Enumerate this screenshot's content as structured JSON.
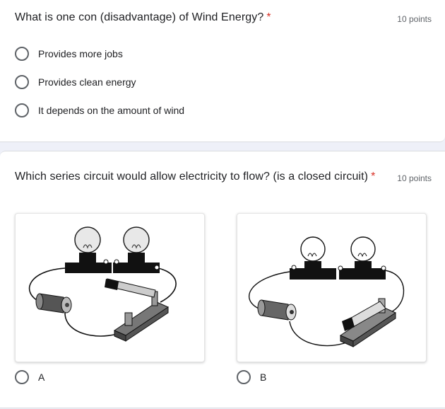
{
  "questions": [
    {
      "title": "What is one con (disadvantage) of Wind Energy?",
      "required_mark": "*",
      "points": "10 points",
      "options": [
        "Provides more jobs",
        "Provides clean energy",
        "It depends on the amount of wind"
      ]
    },
    {
      "title": "Which series circuit would allow electricity to flow? (is a closed circuit)",
      "required_mark": "*",
      "points": "10 points",
      "image_options": [
        "A",
        "B"
      ]
    }
  ],
  "colors": {
    "background": "#eef0f8",
    "required": "#d93025",
    "radio_border": "#5f6368",
    "secondary_text": "#5f6368"
  },
  "icons": {
    "radio": "radio-unchecked-icon",
    "option_images": [
      "circuit-open-switch-image",
      "circuit-closed-switch-image"
    ]
  }
}
